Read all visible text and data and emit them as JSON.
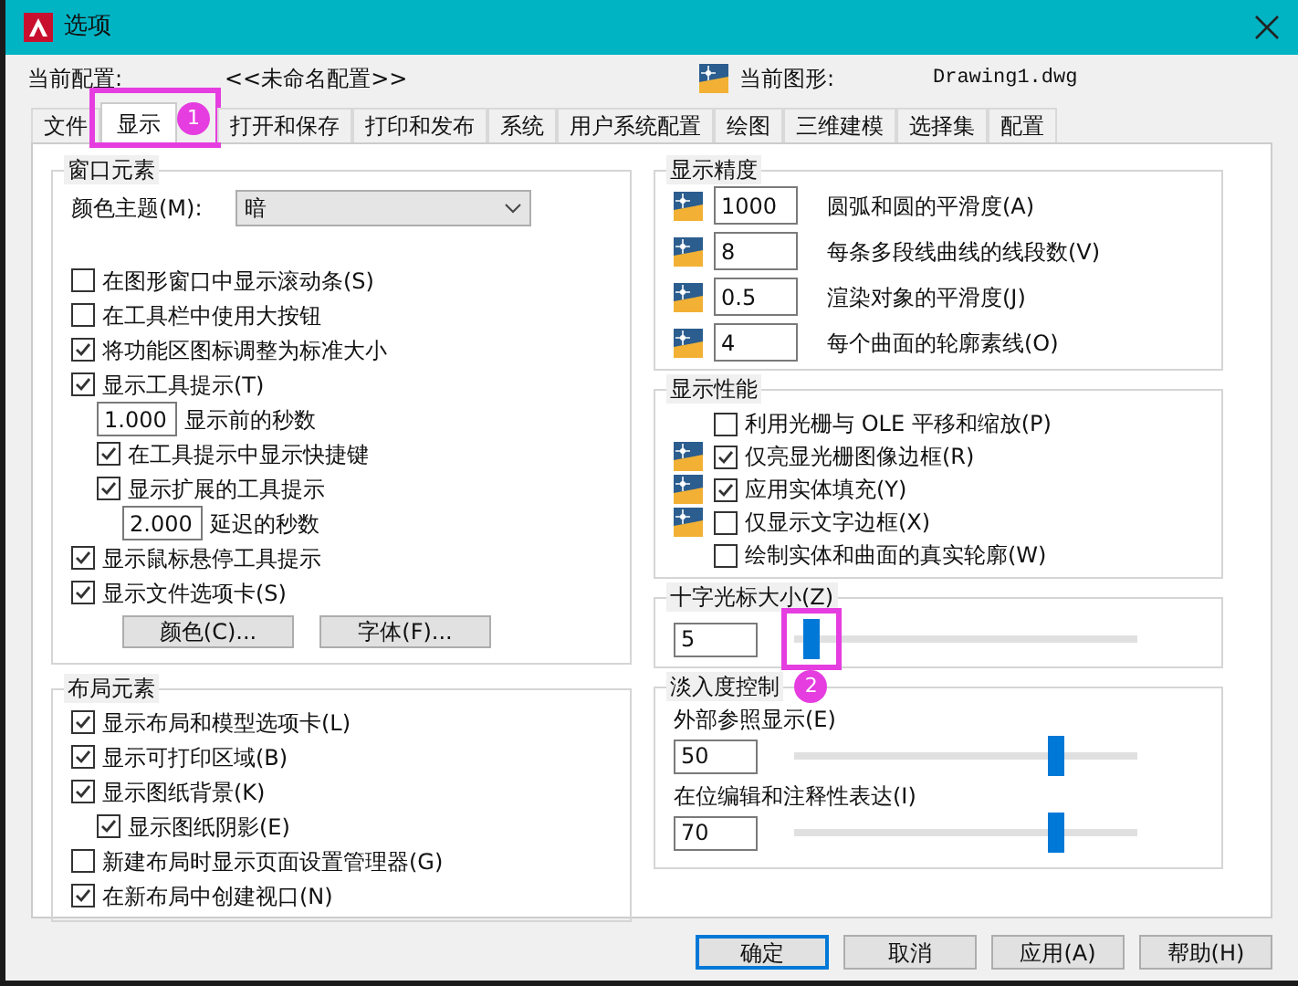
{
  "window": {
    "title": "选项"
  },
  "profile": {
    "label": "当前配置:",
    "value": "<<未命名配置>>"
  },
  "drawing": {
    "label": "当前图形:",
    "value": "Drawing1.dwg"
  },
  "tabs": [
    {
      "label": "文件",
      "selected": false
    },
    {
      "label": "显示",
      "selected": true,
      "callout": "1"
    },
    {
      "label": "打开和保存",
      "selected": false
    },
    {
      "label": "打印和发布",
      "selected": false
    },
    {
      "label": "系统",
      "selected": false
    },
    {
      "label": "用户系统配置",
      "selected": false
    },
    {
      "label": "绘图",
      "selected": false
    },
    {
      "label": "三维建模",
      "selected": false
    },
    {
      "label": "选择集",
      "selected": false
    },
    {
      "label": "配置",
      "selected": false
    }
  ],
  "window_elements": {
    "title": "窗口元素",
    "theme_label": "颜色主题(M):",
    "theme_value": "暗",
    "items": [
      {
        "kind": "checkbox",
        "label": "在图形窗口中显示滚动条(S)",
        "checked": false
      },
      {
        "kind": "checkbox",
        "label": "在工具栏中使用大按钮",
        "checked": false
      },
      {
        "kind": "checkbox",
        "label": "将功能区图标调整为标准大小",
        "checked": true
      },
      {
        "kind": "checkbox",
        "label": "显示工具提示(T)",
        "checked": true,
        "children": [
          {
            "kind": "field",
            "value": "1.000",
            "label": "显示前的秒数"
          },
          {
            "kind": "checkbox",
            "label": "在工具提示中显示快捷键",
            "checked": true
          },
          {
            "kind": "checkbox",
            "label": "显示扩展的工具提示",
            "checked": true,
            "children": [
              {
                "kind": "field",
                "value": "2.000",
                "label": "延迟的秒数"
              }
            ]
          }
        ]
      },
      {
        "kind": "checkbox",
        "label": "显示鼠标悬停工具提示",
        "checked": true
      },
      {
        "kind": "checkbox",
        "label": "显示文件选项卡(S)",
        "checked": true
      }
    ],
    "buttons": [
      "颜色(C)...",
      "字体(F)..."
    ]
  },
  "layout_elements": {
    "title": "布局元素",
    "items": [
      {
        "kind": "checkbox",
        "label": "显示布局和模型选项卡(L)",
        "checked": true
      },
      {
        "kind": "checkbox",
        "label": "显示可打印区域(B)",
        "checked": true
      },
      {
        "kind": "checkbox",
        "label": "显示图纸背景(K)",
        "checked": true,
        "children": [
          {
            "kind": "checkbox",
            "label": "显示图纸阴影(E)",
            "checked": true
          }
        ]
      },
      {
        "kind": "checkbox",
        "label": "新建布局时显示页面设置管理器(G)",
        "checked": false
      },
      {
        "kind": "checkbox",
        "label": "在新布局中创建视口(N)",
        "checked": true
      }
    ]
  },
  "display_resolution": {
    "title": "显示精度",
    "items": [
      {
        "value": "1000",
        "label": "圆弧和圆的平滑度(A)"
      },
      {
        "value": "8",
        "label": "每条多段线曲线的线段数(V)"
      },
      {
        "value": "0.5",
        "label": "渲染对象的平滑度(J)"
      },
      {
        "value": "4",
        "label": "每个曲面的轮廓素线(O)"
      }
    ]
  },
  "display_performance": {
    "title": "显示性能",
    "items": [
      {
        "label": "利用光栅与 OLE 平移和缩放(P)",
        "checked": false,
        "icon": false
      },
      {
        "label": "仅亮显光栅图像边框(R)",
        "checked": true,
        "icon": true
      },
      {
        "label": "应用实体填充(Y)",
        "checked": true,
        "icon": true
      },
      {
        "label": "仅显示文字边框(X)",
        "checked": false,
        "icon": true
      },
      {
        "label": "绘制实体和曲面的真实轮廓(W)",
        "checked": false,
        "icon": false
      }
    ]
  },
  "crosshair": {
    "title": "十字光标大小(Z)",
    "value": "5",
    "level": 0.05,
    "callout": "2"
  },
  "fade": {
    "title": "淡入度控制",
    "items": [
      {
        "label": "外部参照显示(E)",
        "value": "50",
        "level": 0.76
      },
      {
        "label": "在位编辑和注释性表达(I)",
        "value": "70",
        "level": 0.76
      }
    ]
  },
  "buttons": [
    {
      "label": "确定",
      "default": true
    },
    {
      "label": "取消",
      "default": false
    },
    {
      "label": "应用(A)",
      "default": false
    },
    {
      "label": "帮助(H)",
      "default": false
    }
  ]
}
